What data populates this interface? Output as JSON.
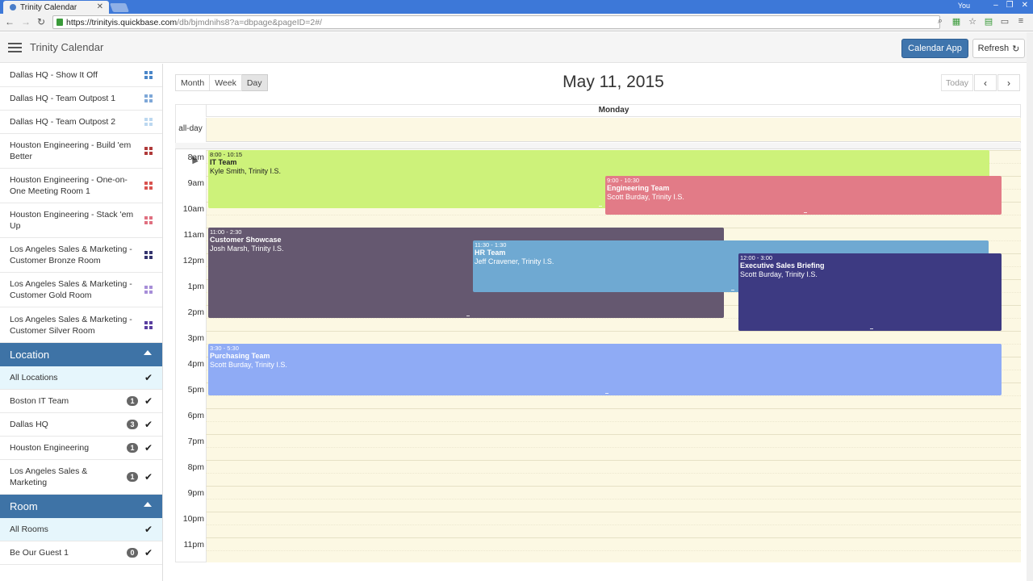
{
  "browser": {
    "tab_title": "Trinity Calendar",
    "tab_close": "✕",
    "user": "You",
    "url_host": "https://trinityis.quickbase.com",
    "url_path": "/db/bjmdnihs8?a=dbpage&pageID=2#/",
    "win_min": "–",
    "win_max": "❐",
    "win_close": "✕",
    "icons": [
      "search-icon",
      "grid-icon",
      "star-icon",
      "extension-icon",
      "cast-icon",
      "menu-icon"
    ]
  },
  "header": {
    "title": "Trinity Calendar",
    "calendar_app_label": "Calendar App",
    "refresh_label": "Refresh",
    "refresh_icon": "↻"
  },
  "sidebar": {
    "rooms": [
      {
        "label": "Dallas HQ - Show It Off",
        "color": "#4a86c8"
      },
      {
        "label": "Dallas HQ - Team Outpost 1",
        "color": "#7fa8d8"
      },
      {
        "label": "Dallas HQ - Team Outpost 2",
        "color": "#bcd8f0"
      },
      {
        "label": "Houston Engineering - Build 'em Better",
        "color": "#b03a3a"
      },
      {
        "label": "Houston Engineering - One-on-One Meeting Room 1",
        "color": "#d9534f"
      },
      {
        "label": "Houston Engineering - Stack 'em Up",
        "color": "#e07080"
      },
      {
        "label": "Los Angeles Sales & Marketing - Customer Bronze Room",
        "color": "#34346e"
      },
      {
        "label": "Los Angeles Sales & Marketing - Customer Gold Room",
        "color": "#a78ed8"
      },
      {
        "label": "Los Angeles Sales & Marketing - Customer Silver Room",
        "color": "#5a3fa0"
      }
    ],
    "location_header": "Location",
    "locations": [
      {
        "label": "All Locations",
        "count": null,
        "selected": true
      },
      {
        "label": "Boston IT Team",
        "count": "1",
        "selected": false
      },
      {
        "label": "Dallas HQ",
        "count": "3",
        "selected": false
      },
      {
        "label": "Houston Engineering",
        "count": "1",
        "selected": false
      },
      {
        "label": "Los Angeles Sales & Marketing",
        "count": "1",
        "selected": false
      }
    ],
    "room_header": "Room",
    "room_filters": [
      {
        "label": "All Rooms",
        "count": null,
        "selected": true
      },
      {
        "label": "Be Our Guest 1",
        "count": "0",
        "selected": false
      }
    ]
  },
  "calendar": {
    "views": [
      {
        "label": "Month",
        "active": false
      },
      {
        "label": "Week",
        "active": false
      },
      {
        "label": "Day",
        "active": true
      }
    ],
    "title": "May 11, 2015",
    "today_label": "Today",
    "prev_icon": "‹",
    "next_icon": "›",
    "day_name": "Monday",
    "all_day_label": "all-day",
    "hours": [
      "8am",
      "9am",
      "10am",
      "11am",
      "12pm",
      "1pm",
      "2pm",
      "3pm",
      "4pm",
      "5pm",
      "6pm",
      "7pm",
      "8pm",
      "9pm",
      "10pm",
      "11pm"
    ],
    "events": [
      {
        "time": "8:00 - 10:15",
        "title": "IT Team",
        "organizer": "Kyle Smith, Trinity I.S.",
        "start": 8.0,
        "end": 10.25,
        "col_start": 0.0,
        "col_end": 0.96,
        "color": "#cdf27a",
        "text_color": "#222"
      },
      {
        "time": "9:00 - 10:30",
        "title": "Engineering Team",
        "organizer": "Scott Burday, Trinity I.S.",
        "start": 9.0,
        "end": 10.5,
        "col_start": 0.487,
        "col_end": 0.975,
        "color": "#e27b87",
        "text_color": "#fff"
      },
      {
        "time": "11:00 - 2:30",
        "title": "Customer Showcase",
        "organizer": "Josh Marsh, Trinity I.S.",
        "start": 11.0,
        "end": 14.5,
        "col_start": 0.0,
        "col_end": 0.635,
        "color": "#655870",
        "text_color": "#fff"
      },
      {
        "time": "11:30 - 1:30",
        "title": "HR Team",
        "organizer": "Jeff Cravener, Trinity I.S.",
        "start": 11.5,
        "end": 13.5,
        "col_start": 0.325,
        "col_end": 0.96,
        "color": "#6fa9d2",
        "text_color": "#fff"
      },
      {
        "time": "12:00 - 3:00",
        "title": "Executive Sales Briefing",
        "organizer": "Scott Burday, Trinity I.S.",
        "start": 12.0,
        "end": 15.0,
        "col_start": 0.65,
        "col_end": 0.975,
        "color": "#3d3a82",
        "text_color": "#fff"
      },
      {
        "time": "3:30 - 5:30",
        "title": "Purchasing Team",
        "organizer": "Scott Burday, Trinity I.S.",
        "start": 15.5,
        "end": 17.5,
        "col_start": 0.0,
        "col_end": 0.975,
        "color": "#8fabf5",
        "text_color": "#fff"
      }
    ]
  }
}
